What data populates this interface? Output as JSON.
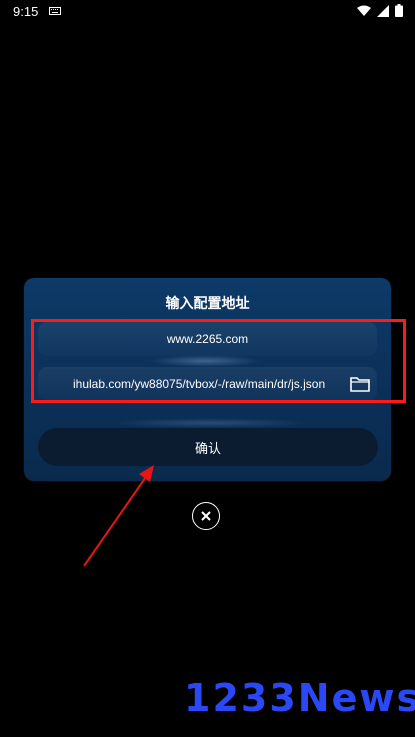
{
  "status_bar": {
    "time": "9:15"
  },
  "dialog": {
    "title": "输入配置地址",
    "fields": [
      {
        "value": "www.2265.com"
      },
      {
        "value": "ihulab.com/yw88075/tvbox/-/raw/main/dr/js.json"
      }
    ],
    "confirm_label": "确认"
  },
  "icons": [
    "keyboard-icon",
    "wifi-icon",
    "signal-icon",
    "battery-icon",
    "folder-icon",
    "close-icon"
  ],
  "colors": {
    "dialog_bg": "#0d3a68",
    "highlight": "#ff1a1a",
    "watermark": "#2a48f5"
  },
  "watermark": "1233News"
}
